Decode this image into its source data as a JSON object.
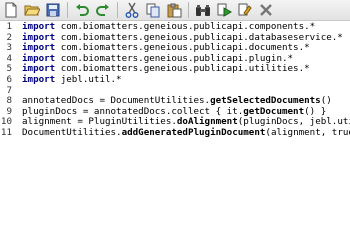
{
  "toolbar": {
    "buttons": [
      {
        "name": "new-file-icon"
      },
      {
        "name": "open-file-icon"
      },
      {
        "name": "save-file-icon"
      },
      {
        "name": "undo-icon"
      },
      {
        "name": "redo-icon"
      },
      {
        "name": "cut-icon"
      },
      {
        "name": "copy-icon"
      },
      {
        "name": "paste-icon"
      },
      {
        "name": "binoculars-icon"
      },
      {
        "name": "run-icon"
      },
      {
        "name": "compile-icon"
      },
      {
        "name": "close-icon"
      }
    ]
  },
  "code": {
    "lines": [
      {
        "num": "1",
        "parts": [
          {
            "t": "import",
            "c": "kw"
          },
          {
            "t": " com.biomatters.geneious.publicapi.components.*",
            "c": ""
          }
        ]
      },
      {
        "num": "2",
        "parts": [
          {
            "t": "import",
            "c": "kw"
          },
          {
            "t": " com.biomatters.geneious.publicapi.databaseservice.*",
            "c": ""
          }
        ]
      },
      {
        "num": "3",
        "parts": [
          {
            "t": "import",
            "c": "kw"
          },
          {
            "t": " com.biomatters.geneious.publicapi.documents.*",
            "c": ""
          }
        ]
      },
      {
        "num": "4",
        "parts": [
          {
            "t": "import",
            "c": "kw"
          },
          {
            "t": " com.biomatters.geneious.publicapi.plugin.*",
            "c": ""
          }
        ]
      },
      {
        "num": "5",
        "parts": [
          {
            "t": "import",
            "c": "kw"
          },
          {
            "t": " com.biomatters.geneious.publicapi.utilities.*",
            "c": ""
          }
        ]
      },
      {
        "num": "6",
        "parts": [
          {
            "t": "import",
            "c": "kw"
          },
          {
            "t": " jebl.util.*",
            "c": ""
          }
        ]
      },
      {
        "num": "7",
        "parts": []
      },
      {
        "num": "8",
        "parts": [
          {
            "t": "annotatedDocs = DocumentUtilities.",
            "c": ""
          },
          {
            "t": "getSelectedDocuments",
            "c": "meth"
          },
          {
            "t": "()",
            "c": ""
          }
        ]
      },
      {
        "num": "9",
        "parts": [
          {
            "t": "pluginDocs = annotatedDocs.collect { it.",
            "c": ""
          },
          {
            "t": "getDocument",
            "c": "meth"
          },
          {
            "t": "() }",
            "c": ""
          }
        ]
      },
      {
        "num": "10",
        "parts": [
          {
            "t": "alignment = PluginUtilities.",
            "c": ""
          },
          {
            "t": "doAlignment",
            "c": "meth"
          },
          {
            "t": "(pluginDocs, jebl.util.Pr",
            "c": ""
          }
        ]
      },
      {
        "num": "11",
        "parts": [
          {
            "t": "DocumentUtilities.",
            "c": ""
          },
          {
            "t": "addGeneratedPluginDocument",
            "c": "meth"
          },
          {
            "t": "(alignment, true)",
            "c": ""
          }
        ]
      }
    ]
  }
}
